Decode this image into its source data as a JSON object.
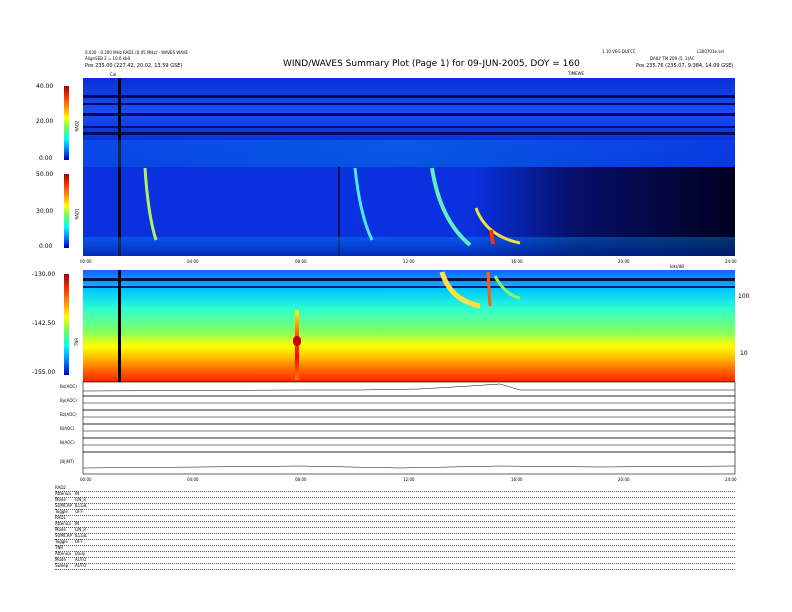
{
  "header": {
    "title": "WIND/WAVES Summary Plot (Page 1) for 09-JUN-2005, DOY = 160",
    "left_line1": "0.030 - 0.200 MHz RAD1 (0.05 MHz) - WAVES WAVE",
    "left_line2": "AlignSEB 2 = 10.0 kb0",
    "left_line3": "Pos   235.00 (227.42, 20.02, 13.59 GSE)",
    "right_line1": "1.10 VEG DUFCC",
    "right_line2": "DAILY TM 209 (5, 3)AC",
    "right_line3": "Pos   235.76 (235.07, 9.384, 14.09 GSE)",
    "far_right_line1": "L300701e.sel",
    "cal_label": "Cal",
    "mid_label": "TIMEWE"
  },
  "panels": {
    "rad2": {
      "label": "RAD2",
      "ticks": [
        "40.00",
        "20.00",
        "0.00"
      ]
    },
    "rad1": {
      "label": "RAD1",
      "ticks": [
        "50.00",
        "30.00",
        "0.00"
      ]
    },
    "tnr": {
      "label": "TNR",
      "ticks": [
        "-130.00",
        "-142.50",
        "-155.00"
      ],
      "right_ticks": [
        "100",
        "10"
      ],
      "right_unit": "kHz"
    },
    "rad_time_ticks": [
      "00:00",
      "04:00",
      "08:00",
      "12:00",
      "16:00",
      "20:00",
      "24:00"
    ],
    "tnr_top_label": "kHz/dB"
  },
  "traces": [
    {
      "label": "Bx(AOC)"
    },
    {
      "label": "By(AOC)"
    },
    {
      "label": "Bz(AOC)"
    },
    {
      "label": "B(AOC)"
    },
    {
      "label": "N(AOC)"
    },
    {
      "label": "|B|(NT)"
    }
  ],
  "bottom_time_ticks": [
    "00:00",
    "04:00",
    "08:00",
    "12:00",
    "16:00",
    "20:00",
    "24:00"
  ],
  "footer": {
    "rows": [
      {
        "k": "RAD2",
        "v": ""
      },
      {
        "k": "Attenua",
        "v": "IN"
      },
      {
        "k": "Mode",
        "v": "LIN_R"
      },
      {
        "k": "SUMCAP",
        "v": "ILLGIL"
      },
      {
        "k": "Toggle",
        "v": "OFF"
      },
      {
        "k": "RAD1",
        "v": ""
      },
      {
        "k": "Attenua",
        "v": "IN"
      },
      {
        "k": "Mode",
        "v": "LIN_R"
      },
      {
        "k": "SUMCAP",
        "v": "ILLGIL"
      },
      {
        "k": "Toggle",
        "v": "OFF"
      },
      {
        "k": "TNR",
        "v": ""
      },
      {
        "k": "Attenua",
        "v": "Daily"
      },
      {
        "k": "Mode",
        "v": "AUTO"
      },
      {
        "k": "Sweep",
        "v": "AUTO"
      }
    ]
  },
  "chart_data": {
    "type": "heatmap",
    "title": "WIND/WAVES Summary Plot (Page 1) for 09-JUN-2005, DOY = 160",
    "x_range": [
      "00:00",
      "24:00"
    ],
    "panels": [
      "RAD2",
      "RAD1",
      "TNR",
      "Bx(AOC)",
      "By(AOC)",
      "Bz(AOC)",
      "B(AOC)",
      "N(AOC)",
      "|B|(NT)"
    ],
    "colorbars": {
      "RAD2": [
        0,
        40
      ],
      "RAD1": [
        0,
        50
      ],
      "TNR": [
        -155,
        -130
      ]
    }
  }
}
